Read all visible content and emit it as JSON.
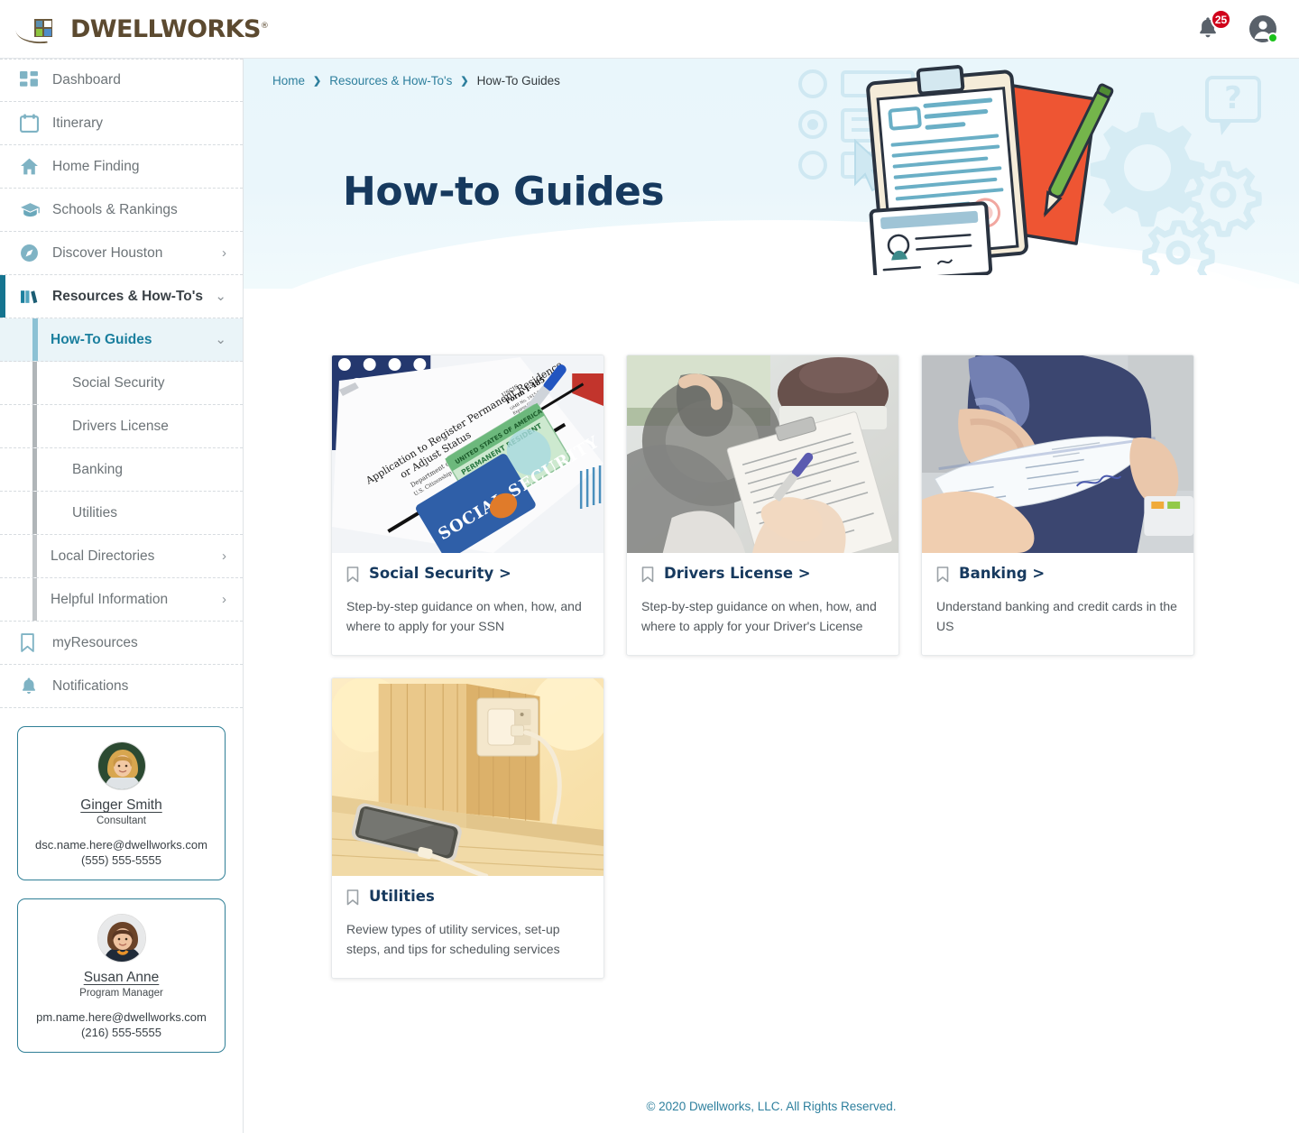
{
  "brand": {
    "logo_text": "DWELLWORKS",
    "logo_trademark": "®",
    "logo_icon": "dwellworks-logo-mark"
  },
  "topbar": {
    "notifications_icon": "bell-icon",
    "notifications_count": "25",
    "account_icon": "user-avatar-icon",
    "status": "online"
  },
  "sidebar": {
    "items": [
      {
        "label": "Dashboard",
        "icon": "dashboard-grid-icon",
        "caret": ""
      },
      {
        "label": "Itinerary",
        "icon": "calendar-icon",
        "caret": ""
      },
      {
        "label": "Home Finding",
        "icon": "home-icon",
        "caret": ""
      },
      {
        "label": "Schools & Rankings",
        "icon": "graduation-cap-icon",
        "caret": ""
      },
      {
        "label": "Discover Houston",
        "icon": "compass-icon",
        "caret": "›"
      },
      {
        "label": "Resources & How-To's",
        "icon": "books-icon",
        "caret": "⌄"
      }
    ],
    "sub_items": [
      {
        "label": "How-To Guides",
        "caret": "⌄"
      },
      {
        "label": "Social Security",
        "caret": ""
      },
      {
        "label": "Drivers License",
        "caret": ""
      },
      {
        "label": "Banking",
        "caret": ""
      },
      {
        "label": "Utilities",
        "caret": ""
      },
      {
        "label": "Local Directories",
        "caret": "›"
      },
      {
        "label": "Helpful Information",
        "caret": "›"
      }
    ],
    "tail_items": [
      {
        "label": "myResources",
        "icon": "bookmark-icon"
      },
      {
        "label": "Notifications",
        "icon": "bell-icon"
      }
    ],
    "contacts": [
      {
        "name": "Ginger Smith",
        "role": "Consultant",
        "email": "dsc.name.here@dwellworks.com",
        "phone": "(555) 555-5555",
        "avatar": "consultant-photo"
      },
      {
        "name": "Susan Anne",
        "role": "Program Manager",
        "email": "pm.name.here@dwellworks.com",
        "phone": "(216) 555-5555",
        "avatar": "program-manager-photo"
      }
    ]
  },
  "breadcrumb": {
    "home": "Home",
    "sep": "❯",
    "section": "Resources & How-To's",
    "current": "How-To Guides"
  },
  "hero": {
    "title": "How-to Guides",
    "illustration": "clipboard-document-gears-illustration"
  },
  "cards": [
    {
      "title": "Social Security >",
      "desc": "Step-by-step guidance on when, how, and where to apply for your SSN",
      "image": "social-security-documents-photo",
      "icon": "bookmark-icon"
    },
    {
      "title": "Drivers License >",
      "desc": "Step-by-step guidance on when, how, and where to apply for your Driver's License",
      "image": "driving-test-clipboard-photo",
      "icon": "bookmark-icon"
    },
    {
      "title": "Banking >",
      "desc": "Understand banking and credit cards in the US",
      "image": "handing-over-check-photo",
      "icon": "bookmark-icon"
    },
    {
      "title": "Utilities",
      "desc": "Review types of utility services, set-up steps, and tips for scheduling services",
      "image": "phone-charging-outlet-photo",
      "icon": "bookmark-icon"
    }
  ],
  "footer": {
    "copyright": "© 2020 Dwellworks, LLC. All Rights Reserved."
  },
  "colors": {
    "accent_teal": "#2d7f9d",
    "title_navy": "#16395e",
    "badge_red": "#d0021b",
    "online_green": "#1bc21b",
    "logo_brown": "#5c4a30"
  }
}
